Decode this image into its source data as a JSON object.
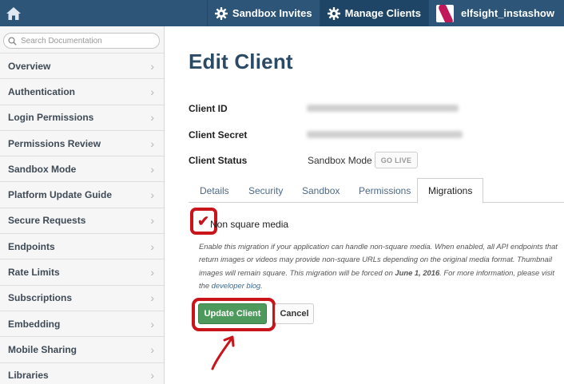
{
  "topbar": {
    "nav": [
      {
        "label": "Sandbox Invites",
        "icon": "gear-icon"
      },
      {
        "label": "Manage Clients",
        "icon": "gear-icon"
      },
      {
        "label": "elfsight_instashow",
        "icon": "app-logo-icon"
      }
    ]
  },
  "sidebar": {
    "search_placeholder": "Search Documentation",
    "items": [
      "Overview",
      "Authentication",
      "Login Permissions",
      "Permissions Review",
      "Sandbox Mode",
      "Platform Update Guide",
      "Secure Requests",
      "Endpoints",
      "Rate Limits",
      "Subscriptions",
      "Embedding",
      "Mobile Sharing",
      "Libraries"
    ]
  },
  "main": {
    "title": "Edit Client",
    "client_id_label": "Client ID",
    "client_secret_label": "Client Secret",
    "client_status_label": "Client Status",
    "client_status_value": "Sandbox Mode",
    "go_live_label": "GO LIVE",
    "tabs": [
      "Details",
      "Security",
      "Sandbox",
      "Permissions",
      "Migrations"
    ],
    "active_tab": "Migrations",
    "migration": {
      "checkbox_label": "Non square media",
      "checked": true,
      "desc_1": "Enable this migration if your application can handle non-square media. When enabled, all API endpoints that return images or videos may provide non-square URLs depending on the original media format. Thumbnail images will remain square. This migration will be forced on ",
      "desc_date": "June 1, 2016",
      "desc_2": ". For more information, please visit the ",
      "desc_link": "developer blog",
      "desc_3": "."
    },
    "update_button": "Update Client",
    "cancel_button": "Cancel"
  },
  "colors": {
    "topbar": "#2c5577",
    "title": "#2b4a66",
    "update_button": "#4e9a5c",
    "annotation_red": "#c9141a"
  }
}
